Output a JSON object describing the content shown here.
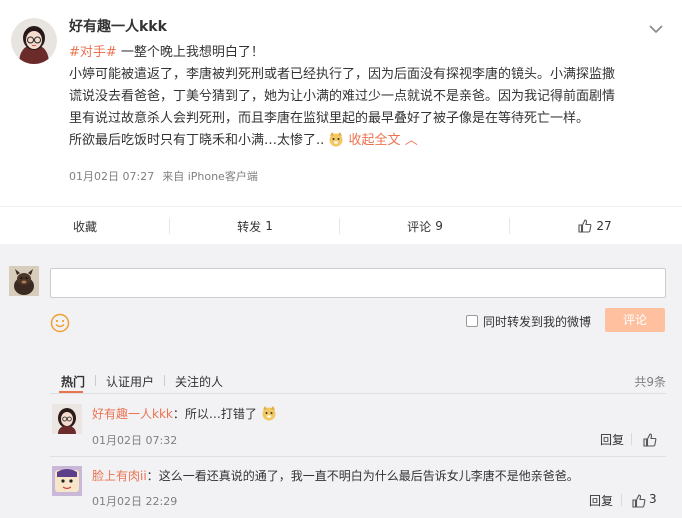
{
  "post": {
    "username": "好有趣一人kkk",
    "avatar": "avatar-girl-glasses",
    "hashtag": "#对手#",
    "headline": " 一整个晚上我想明白了！",
    "line1": "小婷可能被遣返了，李唐被判死刑或者已经执行了，因为后面没有探视李唐的镜头。小满探监撒",
    "line2": "谎说没去看爸爸，丁美兮猜到了，她为让小满的难过少一点就说不是亲爸。因为我记得前面剧情",
    "line3": "里有说过故意杀人会判死刑，而且李唐在监狱里起的最早叠好了被子像是在等待死亡一样。",
    "line4": "所欲最后吃饭时只有丁晓禾和小满…太惨了..",
    "collapse_label": "收起全文",
    "date": "01月02日 07:27",
    "source": "来自 iPhone客户端"
  },
  "actions": {
    "favorite_label": "收藏",
    "repost_label": "转发",
    "repost_count": "1",
    "comment_label": "评论",
    "comment_count": "9",
    "like_count": "27"
  },
  "reply": {
    "repost_checkbox_label": "同时转发到我的微博",
    "submit_label": "评论"
  },
  "filters": {
    "hot": "热门",
    "verified": "认证用户",
    "following": "关注的人",
    "total": "共9条"
  },
  "comments": [
    {
      "name": "好有趣一人kkk",
      "colon": "：",
      "text": "所以…打错了",
      "time": "01月02日 07:32",
      "reply_label": "回复",
      "likes": ""
    },
    {
      "name": "脸上有肉ii",
      "colon": "：",
      "text": "这么一看还真说的通了，我一直不明白为什么最后告诉女儿李唐不是他亲爸爸。",
      "time": "01月02日 22:29",
      "reply_label": "回复",
      "likes": "3"
    }
  ],
  "colors": {
    "accent": "#eb7350",
    "button_disabled": "#ffc09f",
    "meta_gray": "#808080",
    "panel_bg": "#f2f2f5"
  }
}
